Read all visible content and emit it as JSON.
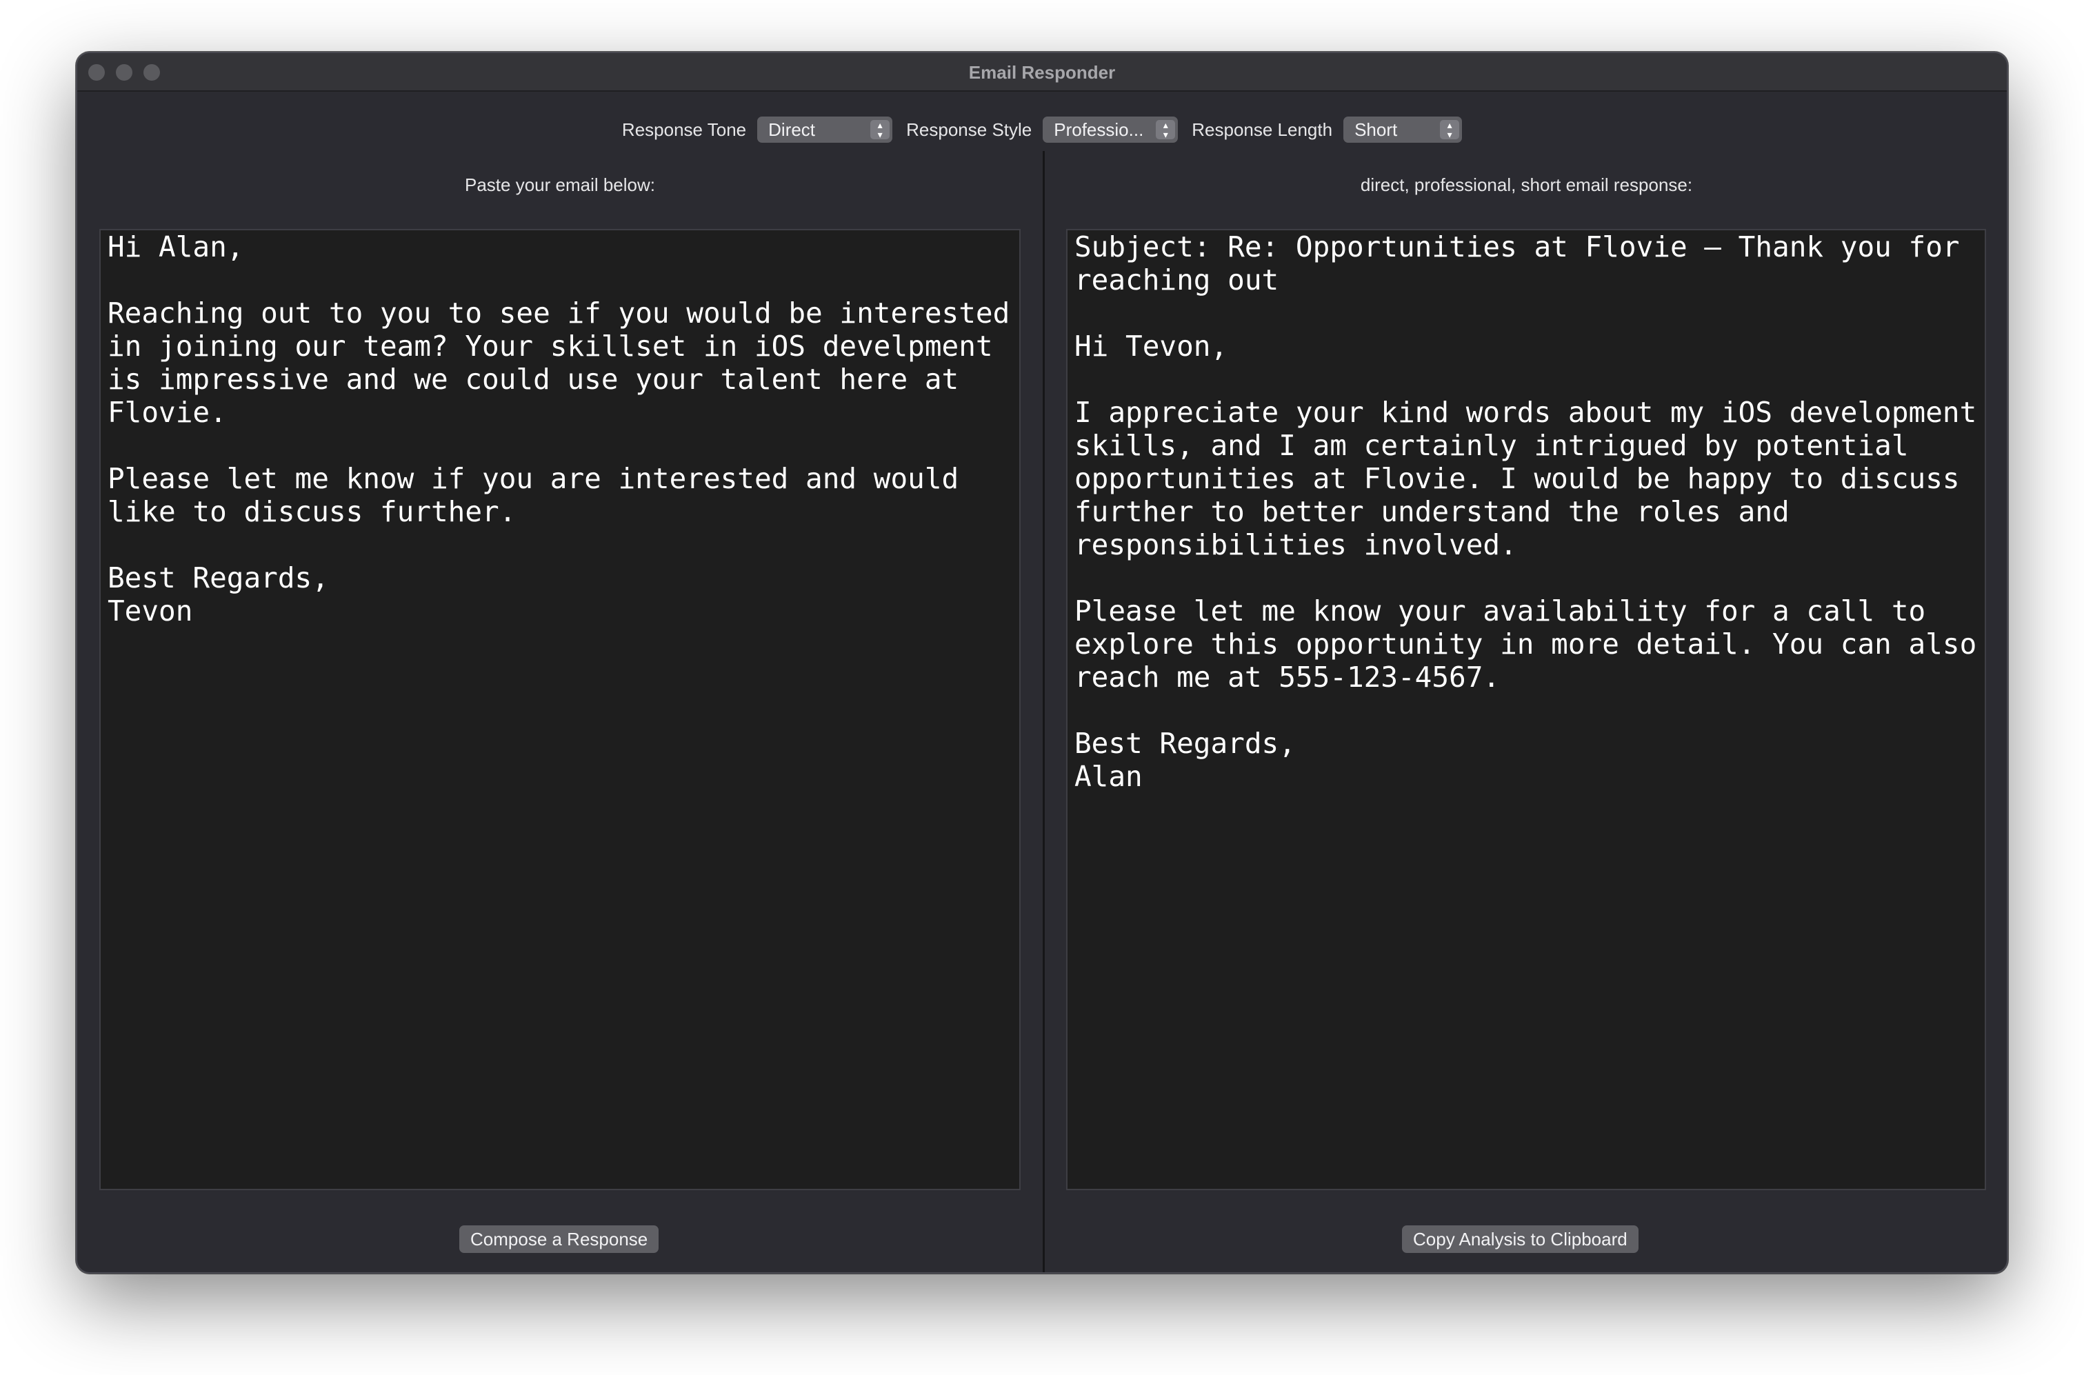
{
  "window": {
    "title": "Email Responder"
  },
  "toolbar": {
    "tone_label": "Response Tone",
    "tone_value": "Direct",
    "style_label": "Response Style",
    "style_value": "Professio...",
    "length_label": "Response Length",
    "length_value": "Short"
  },
  "left_pane": {
    "label": "Paste your email below:",
    "email_text": "Hi Alan,\n\nReaching out to you to see if you would be interested in joining our team? Your skillset in iOS develpment is impressive and we could use your talent here at Flovie.\n\nPlease let me know if you are interested and would like to discuss further.\n\nBest Regards,\nTevon",
    "button_label": "Compose a Response"
  },
  "right_pane": {
    "label": "direct, professional, short email response:",
    "response_text": "Subject: Re: Opportunities at Flovie – Thank you for reaching out\n\nHi Tevon,\n\nI appreciate your kind words about my iOS development skills, and I am certainly intrigued by potential opportunities at Flovie. I would be happy to discuss further to better understand the roles and responsibilities involved.\n\nPlease let me know your availability for a call to explore this opportunity in more detail. You can also reach me at 555-123-4567.\n\nBest Regards,\nAlan",
    "button_label": "Copy Analysis to Clipboard"
  },
  "icons": {
    "popup_arrows": "chevron-up-down-icon",
    "window_controls": "traffic-light-icon"
  },
  "colors": {
    "window_bg": "#2b2b31",
    "textbox_bg": "#1e1e1e",
    "control_bg": "#5f5f64",
    "text": "#ffffff"
  }
}
